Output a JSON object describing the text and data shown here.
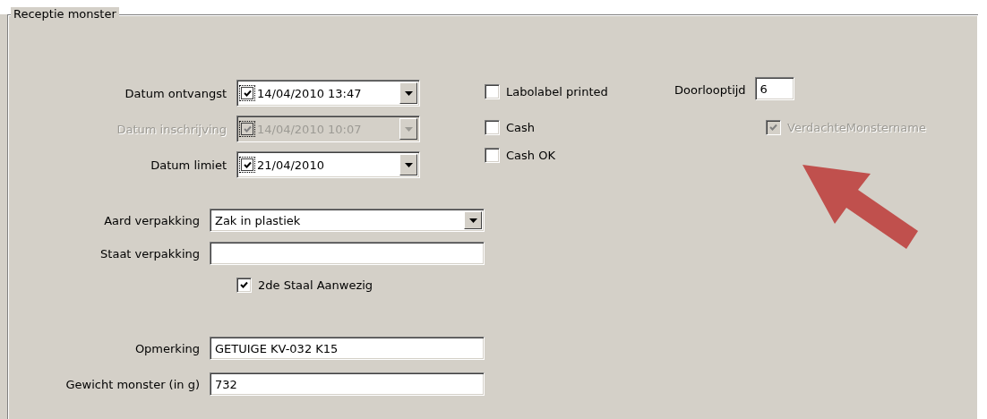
{
  "group": {
    "title": "Receptie monster"
  },
  "date_fields": [
    {
      "label": "Datum ontvangst",
      "value": "14/04/2010 13:47",
      "checked": true,
      "disabled": false
    },
    {
      "label": "Datum inschrijving",
      "value": "14/04/2010 10:07",
      "checked": true,
      "disabled": true
    },
    {
      "label": "Datum limiet",
      "value": "21/04/2010",
      "checked": true,
      "disabled": false
    }
  ],
  "packaging_fields": [
    {
      "kind": "dropdown",
      "label": "Aard verpakking",
      "value": "Zak in plastiek"
    },
    {
      "kind": "text",
      "label": "Staat verpakking"
    }
  ],
  "second_sample": {
    "label": "2de Staal Aanwezig",
    "checked": true,
    "disabled": false
  },
  "fields": [
    {
      "label": "Opmerking",
      "value": "GETUIGE KV-032 K15"
    },
    {
      "label": "Gewicht monster (in g)",
      "value": "732"
    }
  ],
  "checkboxes": [
    {
      "label": "Labolabel printed",
      "checked": false,
      "disabled": false
    },
    {
      "label": "Cash",
      "checked": false,
      "disabled": false
    },
    {
      "label": "Cash OK",
      "checked": false,
      "disabled": false
    }
  ],
  "doorlooptijd": {
    "label": "Doorlooptijd",
    "value": "6"
  },
  "verdachte": {
    "label": "VerdachteMonstername",
    "checked": true,
    "disabled": true
  }
}
